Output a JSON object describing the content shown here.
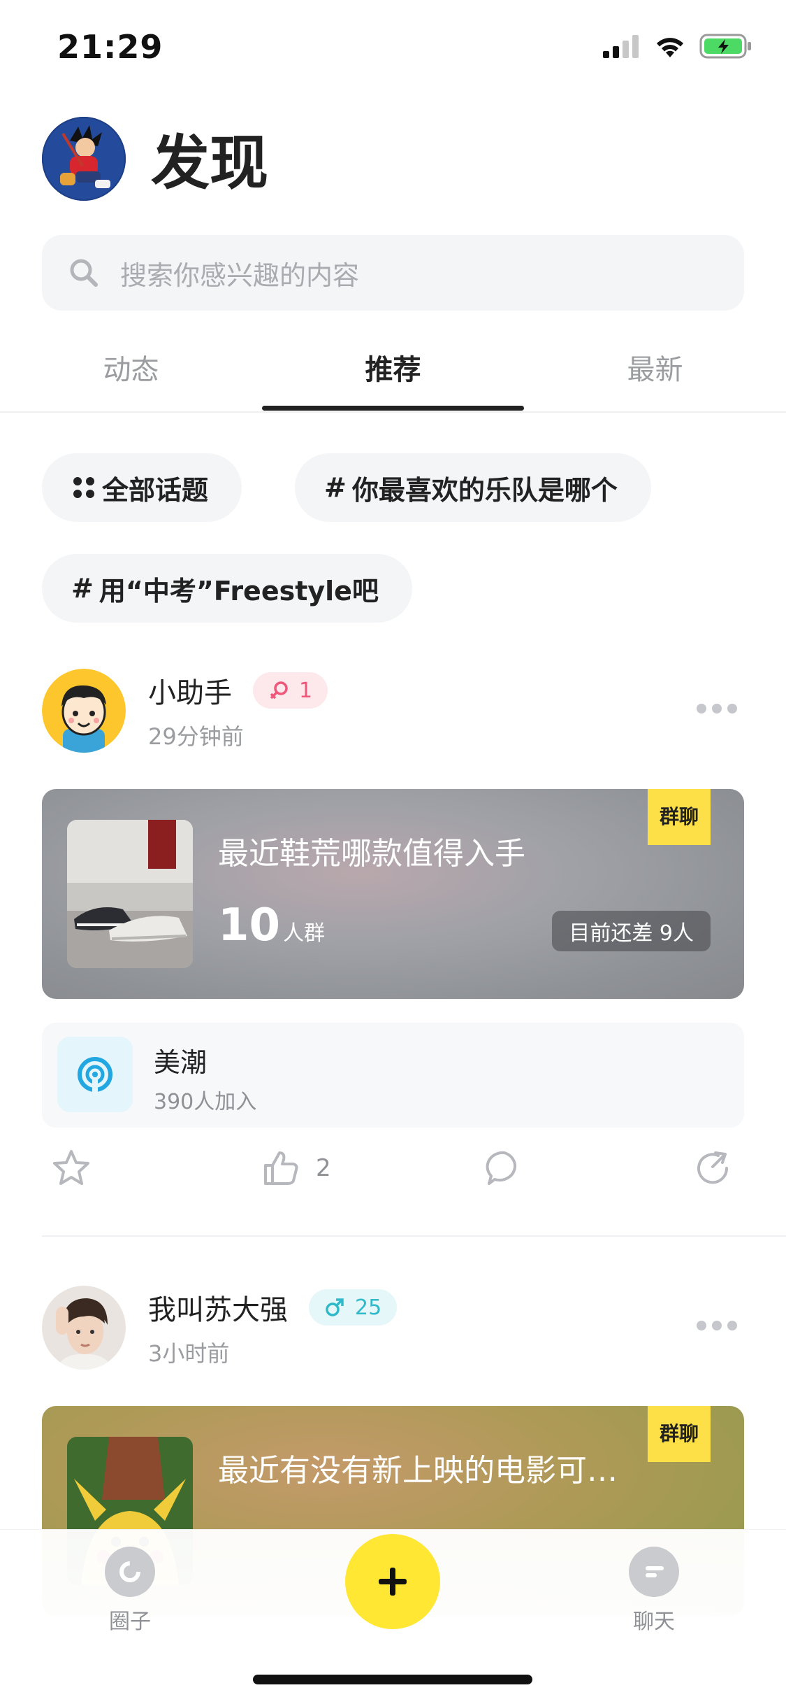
{
  "status_bar": {
    "time": "21:29"
  },
  "header": {
    "title": "发现"
  },
  "search": {
    "placeholder": "搜索你感兴趣的内容"
  },
  "tabs": [
    {
      "label": "动态"
    },
    {
      "label": "推荐",
      "active": true
    },
    {
      "label": "最新"
    }
  ],
  "topics": [
    {
      "label": "全部话题",
      "icon": "grid-dots-icon"
    },
    {
      "label": "你最喜欢的乐队是哪个",
      "icon": "#"
    },
    {
      "label": "用“中考”Freestyle吧",
      "icon": "#"
    }
  ],
  "posts": [
    {
      "name": "小助手",
      "gender": "female",
      "badge": "1",
      "time": "29分钟前",
      "group": {
        "title": "最近鞋荒哪款值得入手",
        "count": "10",
        "count_unit": "人群",
        "need": "目前还差 9人",
        "tag": "群聊",
        "theme": "#9fa1a7"
      },
      "circle": {
        "name": "美潮",
        "members": "390人加入"
      },
      "likes": "2"
    },
    {
      "name": "我叫苏大强",
      "gender": "male",
      "badge": "25",
      "time": "3小时前",
      "group": {
        "title": "最近有没有新上映的电影可…",
        "tag": "群聊",
        "theme": "#ad9a56"
      }
    }
  ],
  "tabbar": {
    "left_label": "圈子",
    "right_label": "聊天",
    "fab_label": "+"
  },
  "colors": {
    "accent_yellow": "#ffe733",
    "female_pink": "#f0567a",
    "male_cyan": "#2fb9c9"
  }
}
